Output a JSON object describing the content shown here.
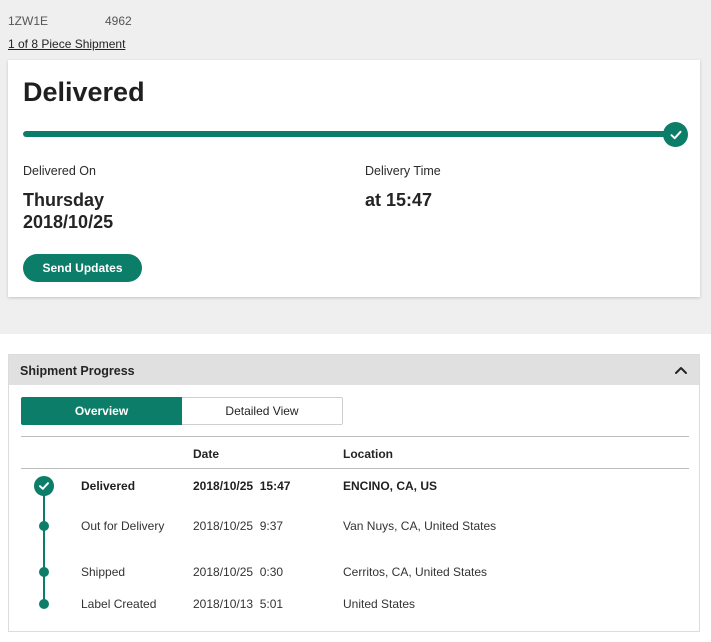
{
  "tracking": {
    "id_prefix": "1ZW1E",
    "id_suffix": "4962",
    "piece_link": "1 of 8 Piece Shipment"
  },
  "status_card": {
    "title": "Delivered",
    "progress_percent": 100,
    "delivered_on_label": "Delivered On",
    "delivered_day": "Thursday",
    "delivered_date": "2018/10/25",
    "delivery_time_label": "Delivery Time",
    "delivery_time": "at 15:47",
    "send_updates_label": "Send Updates"
  },
  "shipment_progress": {
    "title": "Shipment Progress",
    "collapse_icon": "chevron-up-icon",
    "tabs": [
      {
        "label": "Overview",
        "active": true
      },
      {
        "label": "Detailed View",
        "active": false
      }
    ],
    "columns": {
      "date": "Date",
      "location": "Location"
    },
    "events": [
      {
        "status": "Delivered",
        "date": "2018/10/25  15:47",
        "location": "ENCINO, CA, US",
        "marker": "check-circle-icon"
      },
      {
        "status": "Out for Delivery",
        "date": "2018/10/25  9:37",
        "location": "Van Nuys, CA, United States",
        "marker": "dot-icon"
      },
      {
        "status": "Shipped",
        "date": "2018/10/25  0:30",
        "location": "Cerritos, CA, United States",
        "marker": "dot-icon"
      },
      {
        "status": "Label Created",
        "date": "2018/10/13  5:01",
        "location": "United States",
        "marker": "dot-icon"
      }
    ]
  },
  "colors": {
    "accent": "#0c7d68",
    "band_background": "#efefef",
    "panel_header": "#e0e0e0"
  }
}
